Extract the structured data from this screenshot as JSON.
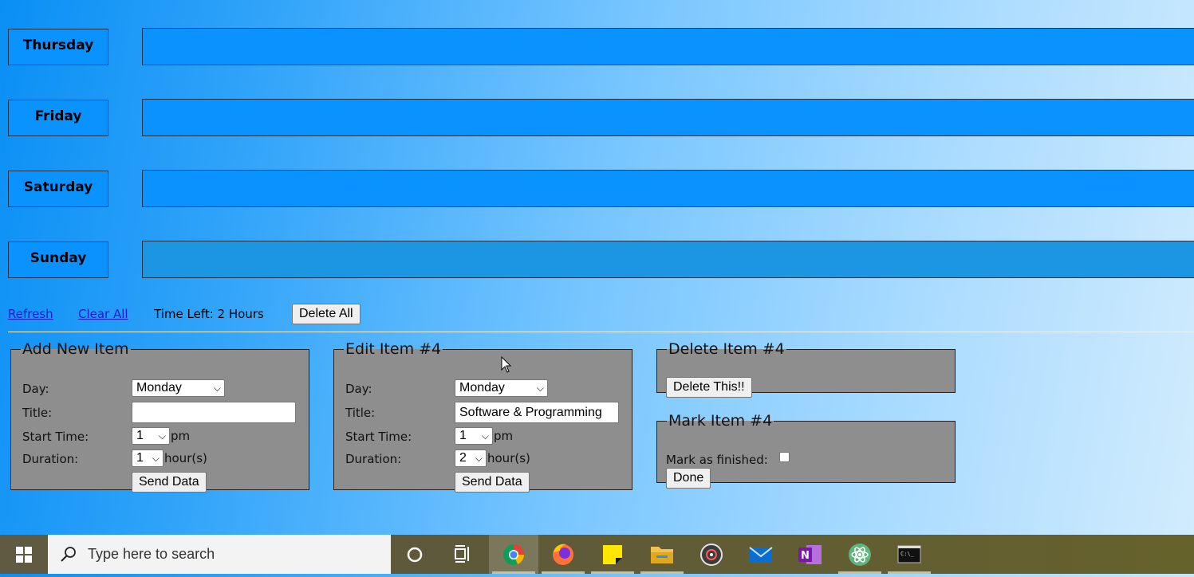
{
  "days": [
    {
      "label": "Thursday"
    },
    {
      "label": "Friday"
    },
    {
      "label": "Saturday"
    },
    {
      "label": "Sunday"
    }
  ],
  "controls": {
    "refresh_label": "Refresh",
    "clear_all_label": "Clear All",
    "time_left": "Time Left: 2 Hours",
    "delete_all_label": "Delete All"
  },
  "add_item": {
    "legend": "Add New Item",
    "day_label": "Day:",
    "day_value": "Monday",
    "title_label": "Title:",
    "title_value": "",
    "start_label": "Start Time:",
    "start_value": "1",
    "start_unit": "pm",
    "duration_label": "Duration:",
    "duration_value": "1",
    "duration_unit": "hour(s)",
    "submit_label": "Send Data"
  },
  "edit_item": {
    "legend": "Edit Item #4",
    "day_label": "Day:",
    "day_value": "Monday",
    "title_label": "Title:",
    "title_value": "Software & Programming",
    "start_label": "Start Time:",
    "start_value": "1",
    "start_unit": "pm",
    "duration_label": "Duration:",
    "duration_value": "2",
    "duration_unit": "hour(s)",
    "submit_label": "Send Data"
  },
  "delete_item": {
    "legend": "Delete Item #4",
    "button_label": "Delete This!!"
  },
  "mark_item": {
    "legend": "Mark Item #4",
    "finished_label": "Mark as finished:",
    "finished_checked": false,
    "done_label": "Done"
  },
  "taskbar": {
    "search_placeholder": "Type here to search",
    "apps": [
      "cortana-icon",
      "task-view-icon",
      "chrome-icon",
      "firefox-icon",
      "sticky-notes-icon",
      "file-explorer-icon",
      "groove-music-icon",
      "mail-icon",
      "onenote-icon",
      "atom-icon",
      "terminal-icon"
    ]
  }
}
